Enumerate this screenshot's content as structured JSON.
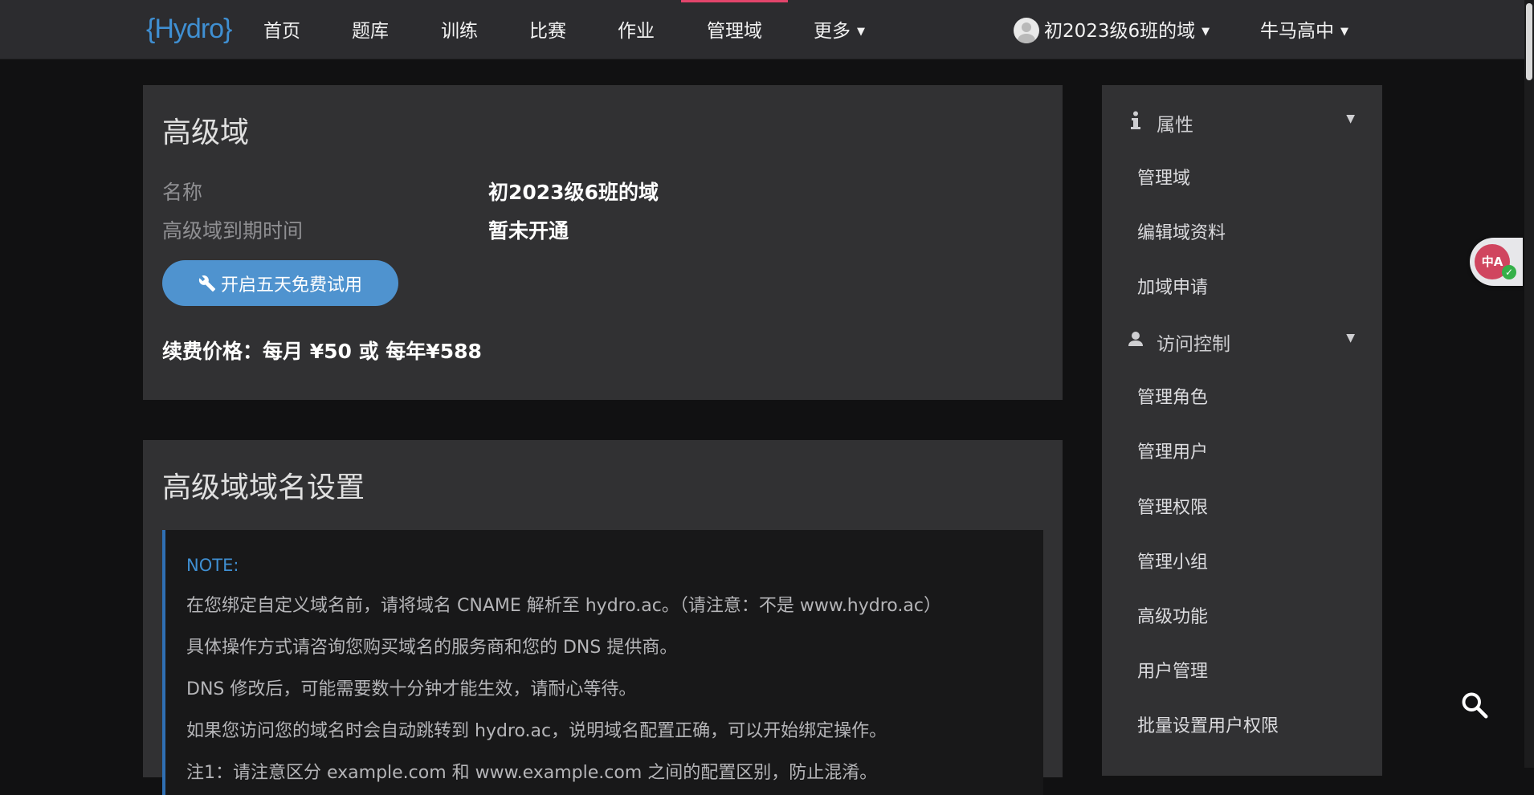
{
  "nav": {
    "logo": "{Hydro}",
    "items": [
      "首页",
      "题库",
      "训练",
      "比赛",
      "作业",
      "管理域",
      "更多"
    ],
    "active": "管理域",
    "domain_switch": "初2023级6班的域",
    "user": "牛马高中"
  },
  "card1": {
    "title": "高级域",
    "rows": [
      {
        "label": "名称",
        "value": "初2023级6班的域"
      },
      {
        "label": "高级域到期时间",
        "value": "暂未开通"
      }
    ],
    "trial_button": "开启五天免费试用",
    "price": "续费价格：每月 ¥50 或 每年¥588"
  },
  "card2": {
    "title": "高级域域名设置",
    "note_title": "NOTE:",
    "note_lines": [
      "在您绑定自定义域名前，请将域名 CNAME 解析至 hydro.ac。（请注意：不是 www.hydro.ac）",
      "具体操作方式请咨询您购买域名的服务商和您的 DNS 提供商。",
      "DNS 修改后，可能需要数十分钟才能生效，请耐心等待。",
      "如果您访问您的域名时会自动跳转到 hydro.ac，说明域名配置正确，可以开始绑定操作。",
      "注1：请注意区分 example.com 和 www.example.com 之间的配置区别，防止混淆。"
    ]
  },
  "sidebar": {
    "sections": [
      {
        "title": "属性",
        "icon": "info-icon",
        "items": [
          "管理域",
          "编辑域资料",
          "加域申请"
        ]
      },
      {
        "title": "访问控制",
        "icon": "user-icon",
        "items": [
          "管理角色",
          "管理用户",
          "管理权限",
          "管理小组",
          "高级功能",
          "用户管理",
          "批量设置用户权限"
        ]
      }
    ]
  },
  "widgets": {
    "translate_label": "中A"
  },
  "colors": {
    "accent": "#4f93cf",
    "active_tab": "#e2456b",
    "note_border": "#2f6fb3",
    "note_title": "#3f8fd2"
  }
}
